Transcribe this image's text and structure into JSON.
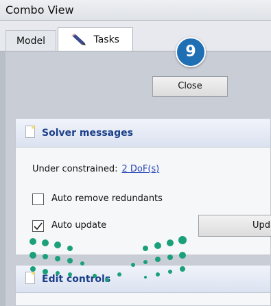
{
  "window": {
    "title": "Combo View"
  },
  "tabs": [
    {
      "label": "Model",
      "active": false
    },
    {
      "label": "Tasks",
      "active": true,
      "icon": "pencil-icon"
    }
  ],
  "task_panel": {
    "close_label": "Close",
    "step_badge": "9"
  },
  "solver_messages": {
    "title": "Solver messages",
    "constraint_text": "Under constrained:",
    "dof_link": "2 DoF(s)",
    "auto_remove_label": "Auto remove redundants",
    "auto_remove_checked": false,
    "auto_update_label": "Auto update",
    "auto_update_checked": true,
    "update_button_label": "Update"
  },
  "edit_controls": {
    "title": "Edit controls"
  },
  "colors": {
    "badge": "#1f6fb5",
    "link": "#2a47b8",
    "panel_title": "#1b3f8a",
    "watermark": "#1aa07a"
  }
}
